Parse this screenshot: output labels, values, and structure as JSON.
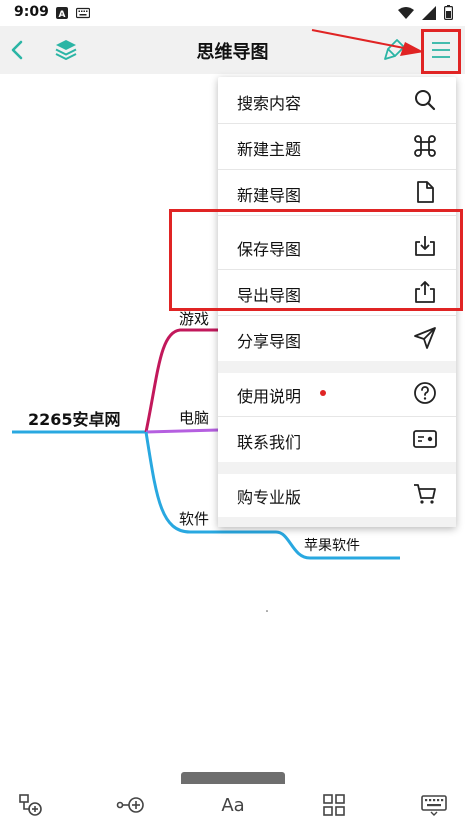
{
  "status_bar": {
    "time": "9:09",
    "icons": [
      "a-badge-icon",
      "keyboard-icon",
      "wifi-icon",
      "signal-icon",
      "battery-icon"
    ]
  },
  "app_bar": {
    "title": "思维导图",
    "accent_color": "#2bb5a5"
  },
  "mindmap": {
    "root": "2265安卓网",
    "branches": [
      {
        "label": "游戏",
        "color": "#c2185b"
      },
      {
        "label": "电脑",
        "color": "#b55fe0"
      },
      {
        "label": "软件",
        "color": "#29a8e0"
      }
    ],
    "sub_nodes": [
      {
        "label": "苹果软件",
        "parent": "软件"
      }
    ]
  },
  "menu": {
    "items": [
      {
        "label": "搜索内容",
        "icon": "search-icon"
      },
      {
        "label": "新建主题",
        "icon": "command-icon"
      },
      {
        "label": "新建导图",
        "icon": "file-icon"
      },
      {
        "label": "保存导图",
        "icon": "download-icon"
      },
      {
        "label": "导出导图",
        "icon": "share-icon"
      },
      {
        "label": "分享导图",
        "icon": "send-icon"
      },
      {
        "label": "使用说明",
        "icon": "help-icon"
      },
      {
        "label": "联系我们",
        "icon": "contact-card-icon"
      },
      {
        "label": "购专业版",
        "icon": "cart-icon"
      }
    ]
  },
  "bottom_bar": {
    "tools": [
      "add-child-node-icon",
      "add-sibling-node-icon",
      "font-icon",
      "layout-grid-icon",
      "keyboard-icon"
    ],
    "font_label": "Aa"
  },
  "annotation_color": "#e02424"
}
